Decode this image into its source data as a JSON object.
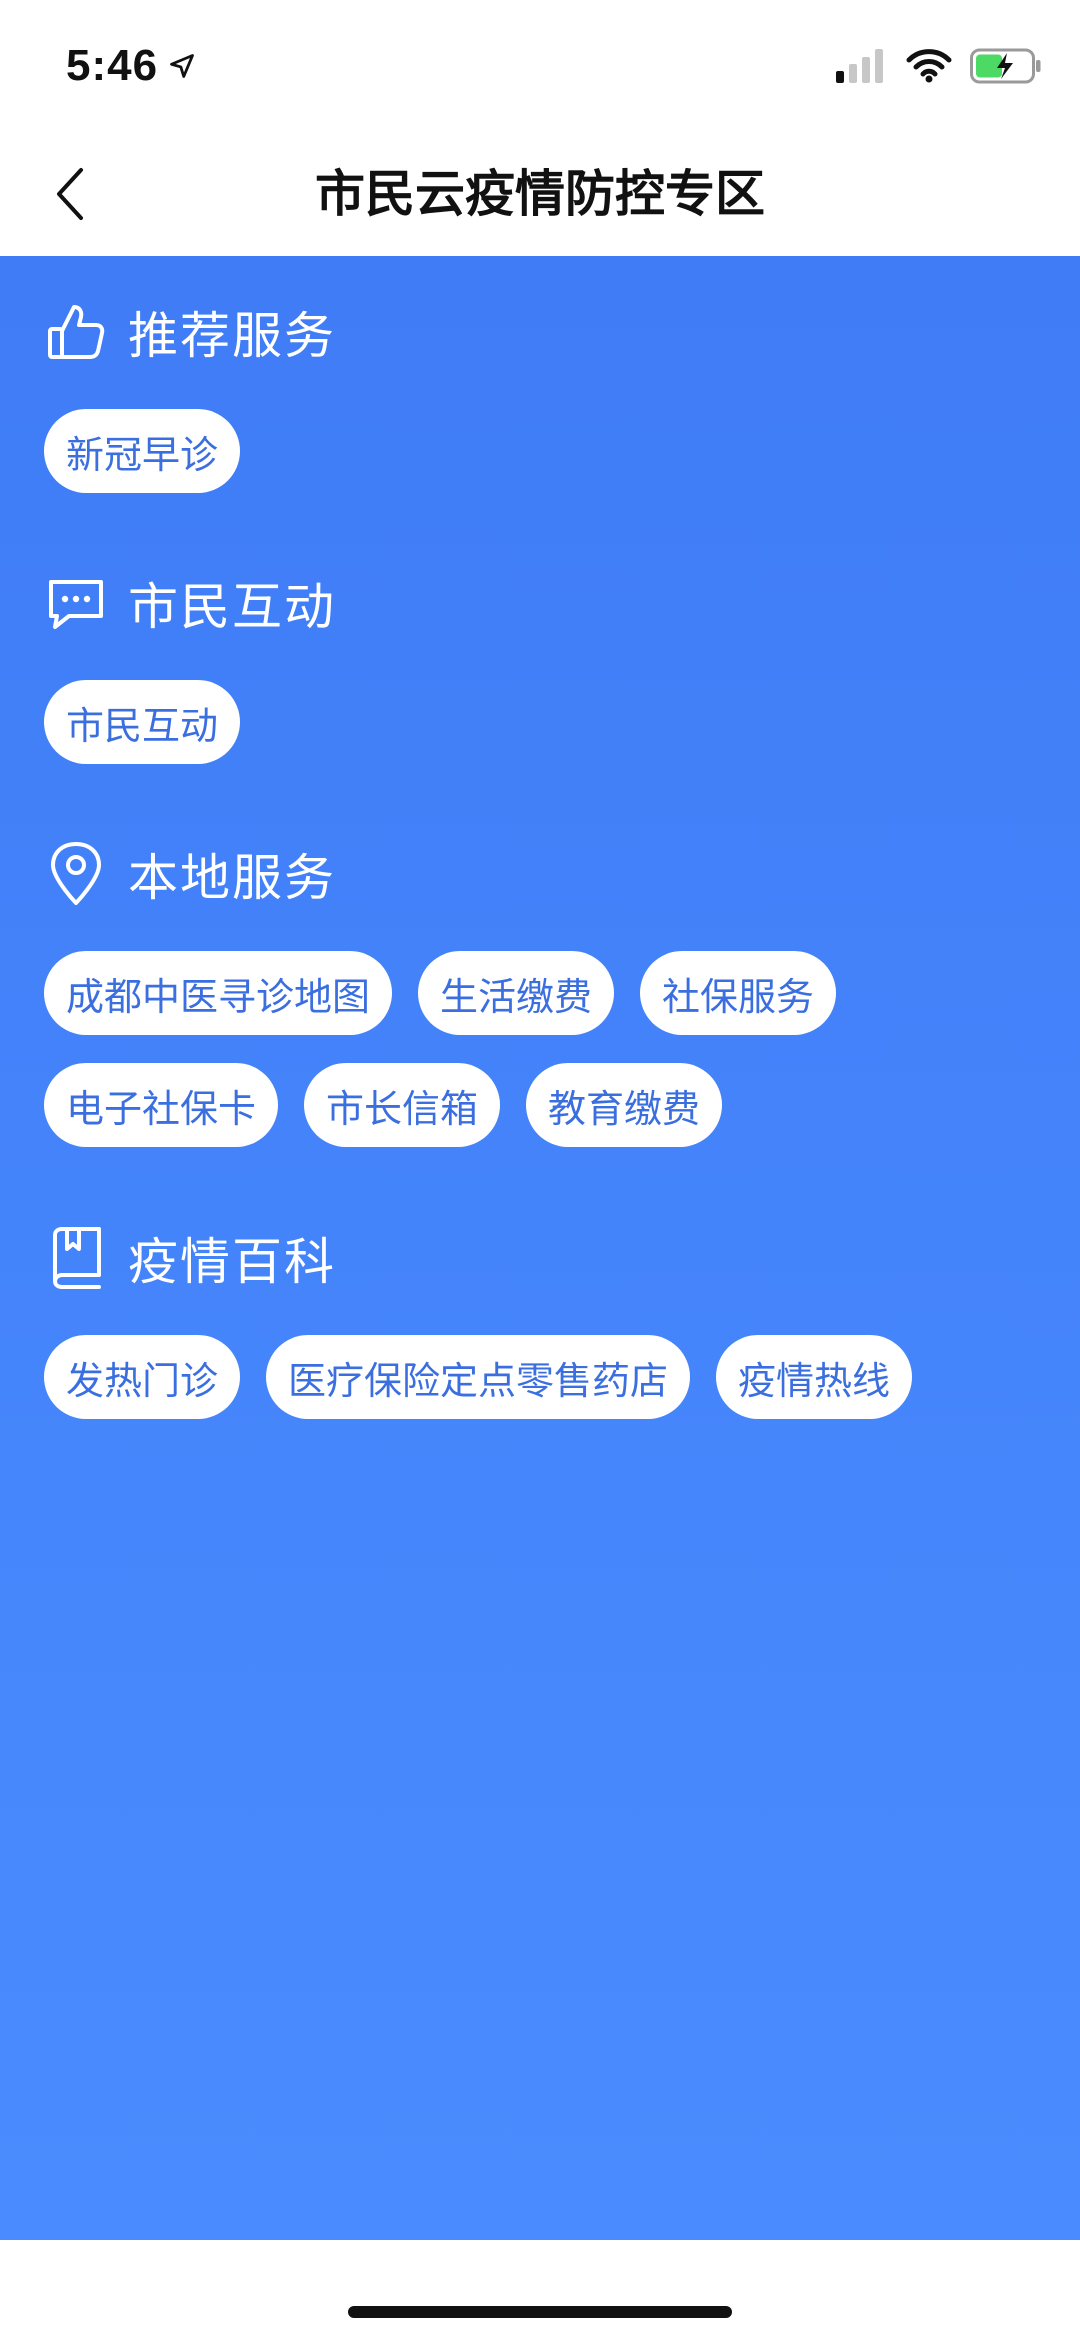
{
  "status_bar": {
    "time": "5:46",
    "icons": [
      "location-arrow-icon",
      "signal-icon",
      "wifi-icon",
      "battery-charging-icon"
    ],
    "battery_color": "#4cd964"
  },
  "nav": {
    "title": "市民云疫情防控专区",
    "back_icon": "chevron-left-icon"
  },
  "theme": {
    "background_top": "#3f7cf6",
    "background_bottom": "#4a8cff",
    "chip_text_color": "#3b6fe0"
  },
  "sections": [
    {
      "title": "推荐服务",
      "icon": "thumbs-up-icon",
      "items": [
        "新冠早诊"
      ]
    },
    {
      "title": "市民互动",
      "icon": "chat-bubble-icon",
      "items": [
        "市民互动"
      ]
    },
    {
      "title": "本地服务",
      "icon": "location-pin-icon",
      "items": [
        "成都中医寻诊地图",
        "生活缴费",
        "社保服务",
        "电子社保卡",
        "市长信箱",
        "教育缴费"
      ]
    },
    {
      "title": "疫情百科",
      "icon": "book-icon",
      "items": [
        "发热门诊",
        "医疗保险定点零售药店",
        "疫情热线"
      ]
    }
  ]
}
